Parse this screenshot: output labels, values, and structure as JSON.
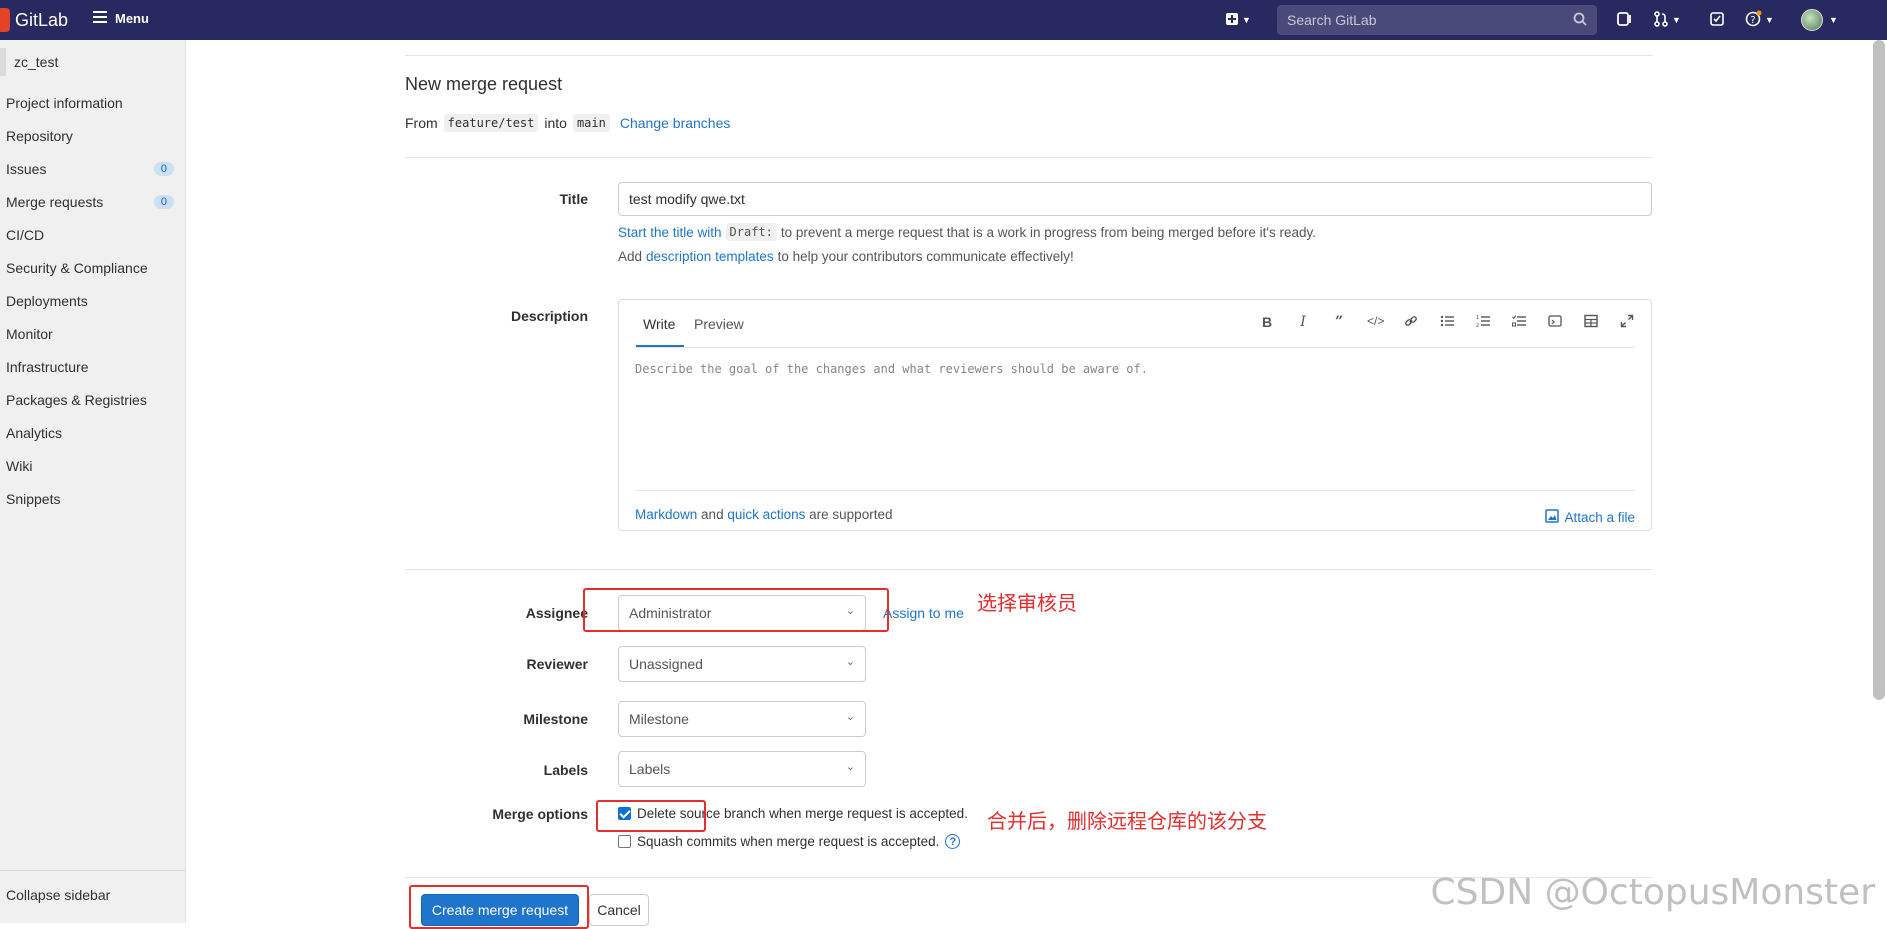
{
  "navbar": {
    "brand": "GitLab",
    "menu_label": "Menu",
    "search_placeholder": "Search GitLab"
  },
  "sidebar": {
    "project_name": "zc_test",
    "items": [
      {
        "label": "Project information",
        "badge": null
      },
      {
        "label": "Repository",
        "badge": null
      },
      {
        "label": "Issues",
        "badge": "0"
      },
      {
        "label": "Merge requests",
        "badge": "0"
      },
      {
        "label": "CI/CD",
        "badge": null
      },
      {
        "label": "Security & Compliance",
        "badge": null
      },
      {
        "label": "Deployments",
        "badge": null
      },
      {
        "label": "Monitor",
        "badge": null
      },
      {
        "label": "Infrastructure",
        "badge": null
      },
      {
        "label": "Packages & Registries",
        "badge": null
      },
      {
        "label": "Analytics",
        "badge": null
      },
      {
        "label": "Wiki",
        "badge": null
      },
      {
        "label": "Snippets",
        "badge": null
      }
    ],
    "collapse_label": "Collapse sidebar"
  },
  "page": {
    "title": "New merge request",
    "from_label": "From",
    "source_branch": "feature/test",
    "into_label": "into",
    "target_branch": "main",
    "change_branches": "Change branches"
  },
  "form": {
    "title_label": "Title",
    "title_value": "test modify qwe.txt",
    "draft_hint_link": "Start the title with",
    "draft_code": "Draft:",
    "draft_hint_rest": "to prevent a merge request that is a work in progress from being merged before it's ready.",
    "templates_prefix": "Add",
    "templates_link": "description templates",
    "templates_rest": "to help your contributors communicate effectively!",
    "description_label": "Description",
    "tab_write": "Write",
    "tab_preview": "Preview",
    "description_placeholder": "Describe the goal of the changes and what reviewers should be aware of.",
    "markdown_link": "Markdown",
    "and_text": "and",
    "quick_actions_link": "quick actions",
    "supported_text": "are supported",
    "attach_file": "Attach a file",
    "assignee_label": "Assignee",
    "assignee_value": "Administrator",
    "assign_to_me": "Assign to me",
    "reviewer_label": "Reviewer",
    "reviewer_value": "Unassigned",
    "milestone_label": "Milestone",
    "milestone_value": "Milestone",
    "labels_label": "Labels",
    "labels_value": "Labels",
    "merge_options_label": "Merge options",
    "delete_branch_text": "Delete source branch when merge request is accepted.",
    "delete_branch_checked": true,
    "squash_text": "Squash commits when merge request is accepted.",
    "squash_checked": false,
    "create_button": "Create merge request",
    "cancel_button": "Cancel"
  },
  "annotations": {
    "assignee_note": "选择审核员",
    "merge_note": "合并后，删除远程仓库的该分支"
  },
  "watermark": "CSDN @OctopusMonster",
  "colors": {
    "navbar": "#292961",
    "link": "#1f75cb",
    "primary_button": "#1f75cb",
    "annotation_red": "#e52d2d"
  }
}
